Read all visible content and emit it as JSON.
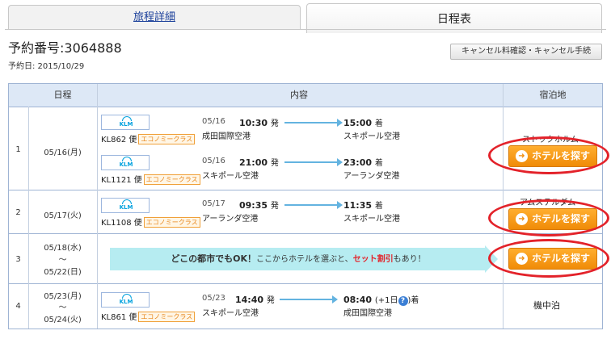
{
  "tabs": {
    "details": "旅程詳細",
    "schedule": "日程表"
  },
  "reservation": {
    "number": "予約番号:3064888",
    "date": "予約日: 2015/10/29"
  },
  "cancel_button": "キャンセル料確認・キャンセル手続",
  "table": {
    "headers": {
      "schedule": "日程",
      "content": "内容",
      "lodging": "宿泊地"
    },
    "rows": [
      {
        "no": "1",
        "date": "05/16(月)",
        "flights": [
          {
            "airline": "KLM",
            "flight": "KL862 便",
            "class": "エコノミークラス",
            "dep_date": "05/16",
            "dep_time": "10:30",
            "dep_label": "発",
            "dep_port": "成田国際空港",
            "arr_time": "15:00",
            "arr_label": "着",
            "arr_port": "スキポール空港"
          },
          {
            "airline": "KLM",
            "flight": "KL1121 便",
            "class": "エコノミークラス",
            "dep_date": "05/16",
            "dep_time": "21:00",
            "dep_label": "発",
            "dep_port": "スキポール空港",
            "arr_time": "23:00",
            "arr_label": "着",
            "arr_port": "アーランダ空港"
          }
        ],
        "hotel": "ストックホルム",
        "hotel_button": "ホテルを探す"
      },
      {
        "no": "2",
        "date": "05/17(火)",
        "flights": [
          {
            "airline": "KLM",
            "flight": "KL1108 便",
            "class": "エコノミークラス",
            "dep_date": "05/17",
            "dep_time": "09:35",
            "dep_label": "発",
            "dep_port": "アーランダ空港",
            "arr_time": "11:35",
            "arr_label": "着",
            "arr_port": "スキポール空港"
          }
        ],
        "hotel": "アムステルダム",
        "hotel_button": "ホテルを探す"
      },
      {
        "no": "3",
        "date_from": "05/18(水)",
        "date_sep": "〜",
        "date_to": "05/22(日)",
        "banner": {
          "part1": "どこの都市でもOK！",
          "part2": "ここからホテルを選ぶと、",
          "highlight": "セット割引",
          "part3": "もあり！"
        },
        "hotel_button": "ホテルを探す"
      },
      {
        "no": "4",
        "date_from": "05/23(月)",
        "date_sep": "〜",
        "date_to": "05/24(火)",
        "flights": [
          {
            "airline": "KLM",
            "flight": "KL861 便",
            "class": "エコノミークラス",
            "dep_date": "05/23",
            "dep_time": "14:40",
            "dep_label": "発",
            "dep_port": "スキポール空港",
            "arr_time": "08:40",
            "arr_next": "(+1日",
            "arr_help": "?",
            "arr_close": ")",
            "arr_label": "着",
            "arr_port": "成田国際空港"
          }
        ],
        "lodging": "機中泊"
      }
    ]
  },
  "colors": {
    "accent_orange": "#f08b08",
    "highlight_red": "#e3222a",
    "header_blue": "#dde8f6",
    "arrow_blue": "#63b3e0"
  }
}
